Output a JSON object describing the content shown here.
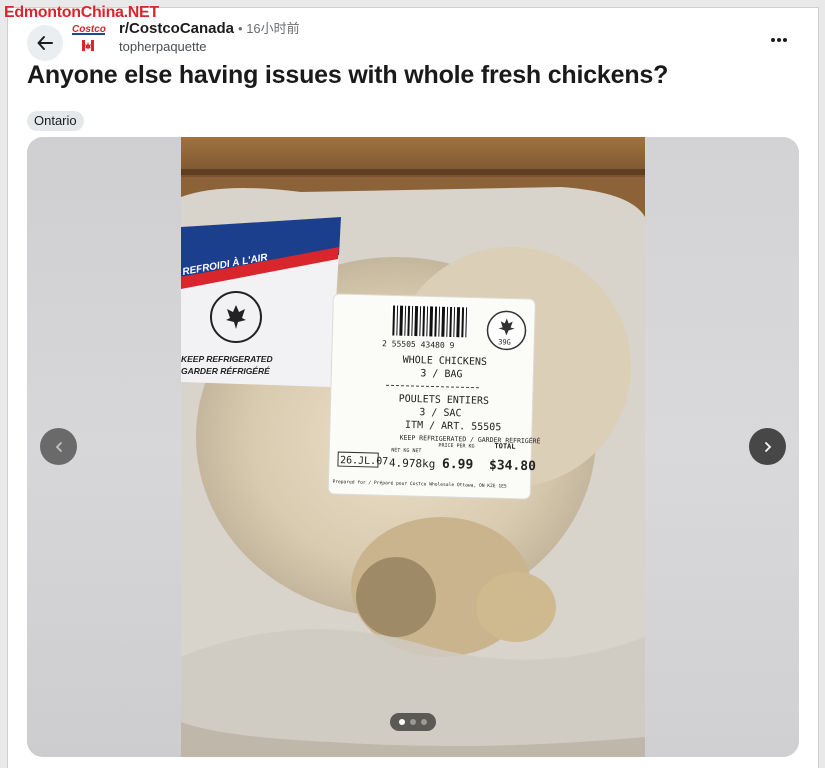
{
  "watermark": "EdmontonChina.NET",
  "post": {
    "subreddit": "r/CostcoCanada",
    "time": "• 16小时前",
    "author": "topherpaquette",
    "title": "Anyone else having issues with whole fresh chickens?",
    "flair": "Ontario"
  },
  "icons": {
    "back": "arrow-left-icon",
    "more": "more-options-icon",
    "prev": "chevron-left-icon",
    "next": "chevron-right-icon"
  },
  "gallery": {
    "current": 1,
    "total": 3
  },
  "photo_label": {
    "bag_text": "REFROIDI À L'AIR",
    "keep_refrigerated": "KEEP REFRIGERATED",
    "garder": "GARDER RÉFRIGÉRÉ",
    "barcode_number": "2 55505 43480 9",
    "badge": "39G",
    "line1": "WHOLE CHICKENS",
    "line2": "3 / BAG",
    "line3": "POULETS ENTIERS",
    "line4": "3 / SAC",
    "line5": "ITM / ART.  55505",
    "line6": "KEEP REFRIGERATED / GARDER REFRIGÉRÉ",
    "date": "26.JL.07",
    "net_label": "NET KG NET",
    "weight": "4.978kg",
    "price_label": "PRICE PER KG",
    "price": "6.99",
    "total_label": "TOTAL",
    "total": "$34.80",
    "footer": "Prepared for / Préparé pour Costco Wholesale Ottawa, ON K2E 1E5"
  },
  "colors": {
    "brand_red": "#d8262c",
    "text": "#1a1a1b"
  }
}
